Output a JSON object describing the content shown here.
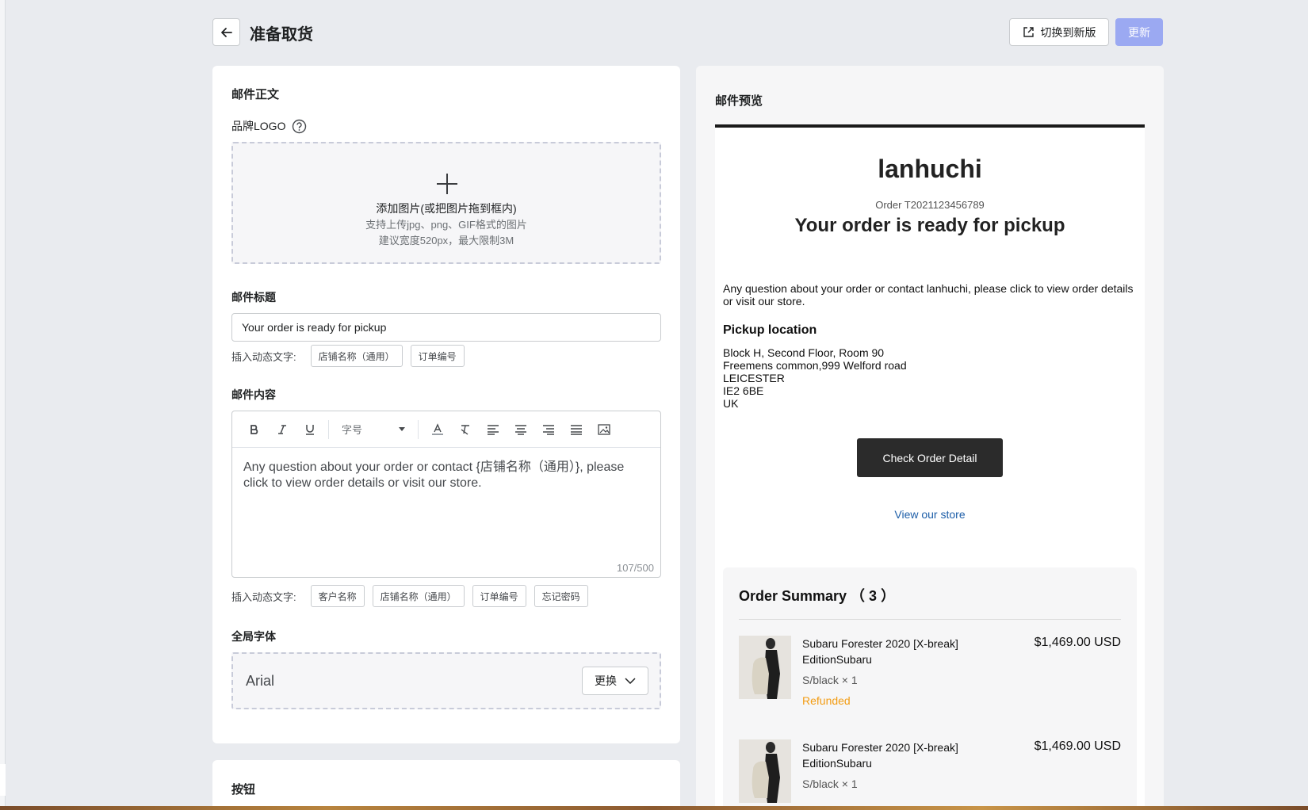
{
  "header": {
    "title": "准备取货",
    "switch_label": "切换到新版",
    "update_label": "更新"
  },
  "body_section": {
    "title": "邮件正文",
    "logo_label": "品牌LOGO",
    "upload": {
      "main": "添加图片(或把图片拖到框内)",
      "formats": "支持上传jpg、png、GIF格式的图片",
      "limits": "建议宽度520px，最大限制3M"
    },
    "subject_label": "邮件标题",
    "subject_value": "Your order is ready for pickup",
    "dynamic_label": "插入动态文字:",
    "subject_tags": [
      "店铺名称（通用）",
      "订单编号"
    ],
    "content_label": "邮件内容",
    "toolbar": {
      "font_size": "字号"
    },
    "content_text": "Any question about your order or contact {店铺名称（通用）}, please click to view order details or visit our store.",
    "counter": "107/500",
    "content_tags": [
      "客户名称",
      "店铺名称（通用）",
      "订单编号",
      "忘记密码"
    ],
    "font_label": "全局字体",
    "font_value": "Arial",
    "font_change": "更换"
  },
  "button_section": {
    "title": "按钮"
  },
  "preview": {
    "title": "邮件预览",
    "store": "lanhuchi",
    "order": "Order T2021123456789",
    "heading": "Your order is ready for pickup",
    "paragraph": "Any question about your order or contact lanhuchi, please click to view order details or visit our store.",
    "location_title": "Pickup location",
    "address": [
      "Block H, Second Floor, Room 90",
      "Freemens common,999 Welford road",
      "LEICESTER",
      "IE2 6BE",
      "UK"
    ],
    "check_button": "Check Order Detail",
    "view_store": "View our store",
    "summary_title": "Order Summary （ 3 ）",
    "items": [
      {
        "name": "Subaru Forester 2020 [X-break] EditionSubaru",
        "variant": "S/black × 1",
        "status": "Refunded",
        "price": "$1,469.00 USD"
      },
      {
        "name": "Subaru Forester 2020 [X-break] EditionSubaru",
        "variant": "S/black × 1",
        "status": "",
        "price": "$1,469.00 USD"
      }
    ]
  },
  "colors": {
    "accent": "#9ba9f2",
    "refunded": "#f39c12",
    "link": "#1d5ea8",
    "dark_button": "#2b2b2b"
  }
}
